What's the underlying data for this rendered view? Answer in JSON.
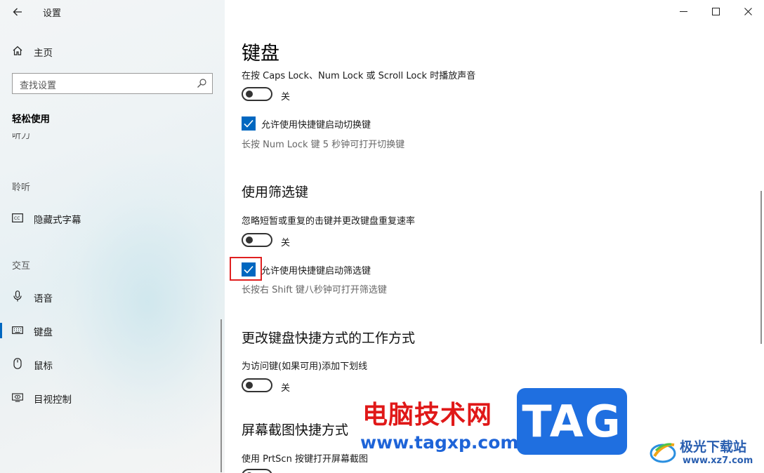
{
  "window": {
    "app_title": "设置",
    "back_icon": "arrow-left-icon",
    "controls": [
      "minimize-icon",
      "maximize-icon",
      "close-icon"
    ]
  },
  "sidebar": {
    "home_label": "主页",
    "search_placeholder": "查找设置",
    "category": "轻松使用",
    "clipped_item": "听力",
    "sections": [
      {
        "label": "聆听",
        "items": [
          {
            "label": "隐藏式字幕",
            "icon": "closed-caption-icon"
          }
        ]
      },
      {
        "label": "交互",
        "items": [
          {
            "label": "语音",
            "icon": "microphone-icon"
          },
          {
            "label": "键盘",
            "icon": "keyboard-icon",
            "active": true
          },
          {
            "label": "鼠标",
            "icon": "mouse-icon"
          },
          {
            "label": "目视控制",
            "icon": "eye-control-icon"
          }
        ]
      }
    ]
  },
  "main": {
    "title": "键盘",
    "toggle_keys": {
      "setting_label": "在按 Caps Lock、Num Lock 或 Scroll Lock 时播放声音",
      "toggle_state": "关",
      "checkbox_label": "允许使用快捷键启动切换键",
      "checkbox_checked": true,
      "hint": "长按 Num Lock 键 5 秒钟可打开切换键"
    },
    "filter_keys": {
      "heading": "使用筛选键",
      "setting_label": "忽略短暂或重复的击键并更改键盘重复速率",
      "toggle_state": "关",
      "checkbox_label": "允许使用快捷键启动筛选键",
      "checkbox_checked": true,
      "hint": "长按右 Shift 键八秒钟可打开筛选键"
    },
    "shortcuts": {
      "heading": "更改键盘快捷方式的工作方式",
      "setting_label": "为访问键(如果可用)添加下划线",
      "toggle_state": "关"
    },
    "print_screen": {
      "heading": "屏幕截图快捷方式",
      "setting_label": "使用 PrtScn 按键打开屏幕截图"
    }
  },
  "watermark": {
    "site_cn": "电脑技术网",
    "site_url": "www.tagxp.com",
    "tag_logo": "TAG",
    "site2_name": "极光下载站",
    "site2_url": "www.xz7.com"
  },
  "colors": {
    "accent": "#0067c0",
    "highlight_box": "#e02020",
    "watermark_red": "#e01818",
    "watermark_blue": "#1f6fe0"
  }
}
